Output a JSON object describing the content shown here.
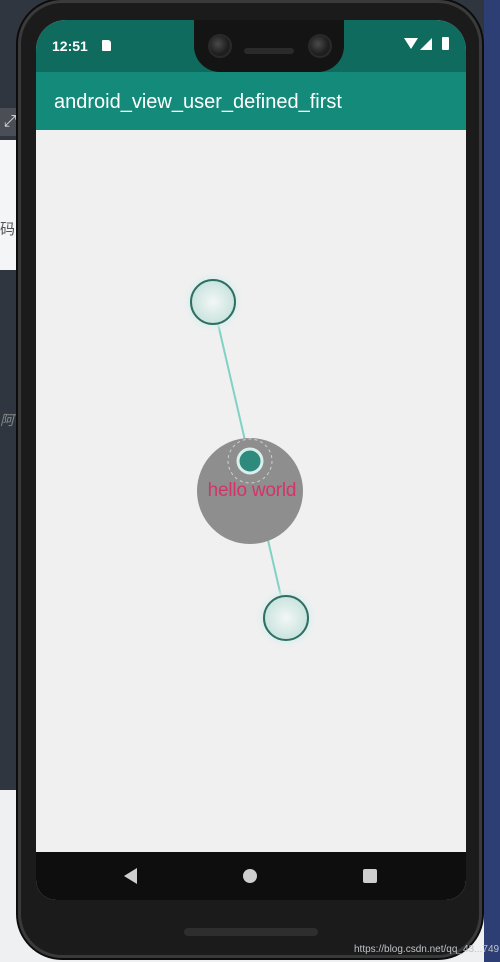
{
  "status_bar": {
    "time": "12:51",
    "icons": [
      "sd-card-icon",
      "wifi-icon",
      "signal-icon",
      "battery-icon"
    ]
  },
  "app_bar": {
    "title": "android_view_user_defined_first"
  },
  "canvas": {
    "center_label": "hello world",
    "colors": {
      "line": "#7fd2c4",
      "disc": "#8e8e8e",
      "label": "#d4336a",
      "anchor_fill": "#d7ece8",
      "anchor_stroke": "#2e6f64",
      "center_fill": "#2e8a7c"
    }
  },
  "navigation_bar": {
    "buttons": [
      "back-icon",
      "home-icon",
      "recent-apps-icon"
    ]
  },
  "background_page": {
    "text_1": "码 :",
    "text_2": "阿等"
  },
  "watermark": "https://blog.csdn.net/qq_43...749"
}
